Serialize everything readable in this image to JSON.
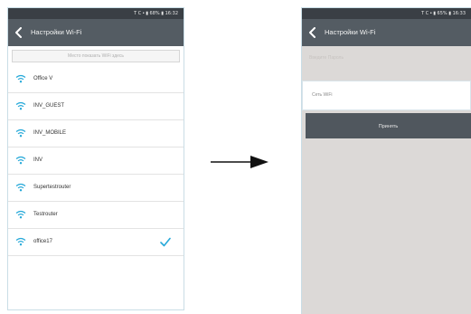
{
  "left_screen": {
    "status_text": "Т С • ▮ 68% ▮ 16:32",
    "title": "Настройки Wi-Fi",
    "hint": "Место показать WiFi здесь",
    "networks": [
      {
        "name": "Office V",
        "selected": false
      },
      {
        "name": "INV_GUEST",
        "selected": false
      },
      {
        "name": "INV_MOBILE",
        "selected": false
      },
      {
        "name": "INV",
        "selected": false
      },
      {
        "name": "Supertestrouter",
        "selected": false
      },
      {
        "name": "Testrouter",
        "selected": false
      },
      {
        "name": "office17",
        "selected": true
      }
    ]
  },
  "right_screen": {
    "status_text": "Т С • ▮ 65% ▮ 16:33",
    "title": "Настройки Wi-Fi",
    "top_placeholder": "Введите Пароль",
    "field_label": "Сеть WiFi",
    "apply_label": "Принять"
  },
  "colors": {
    "accent": "#27a9d9",
    "appbar": "#545c63",
    "statusbar": "#3a3f45",
    "button": "#50575e",
    "panel": "#dcd9d7"
  }
}
